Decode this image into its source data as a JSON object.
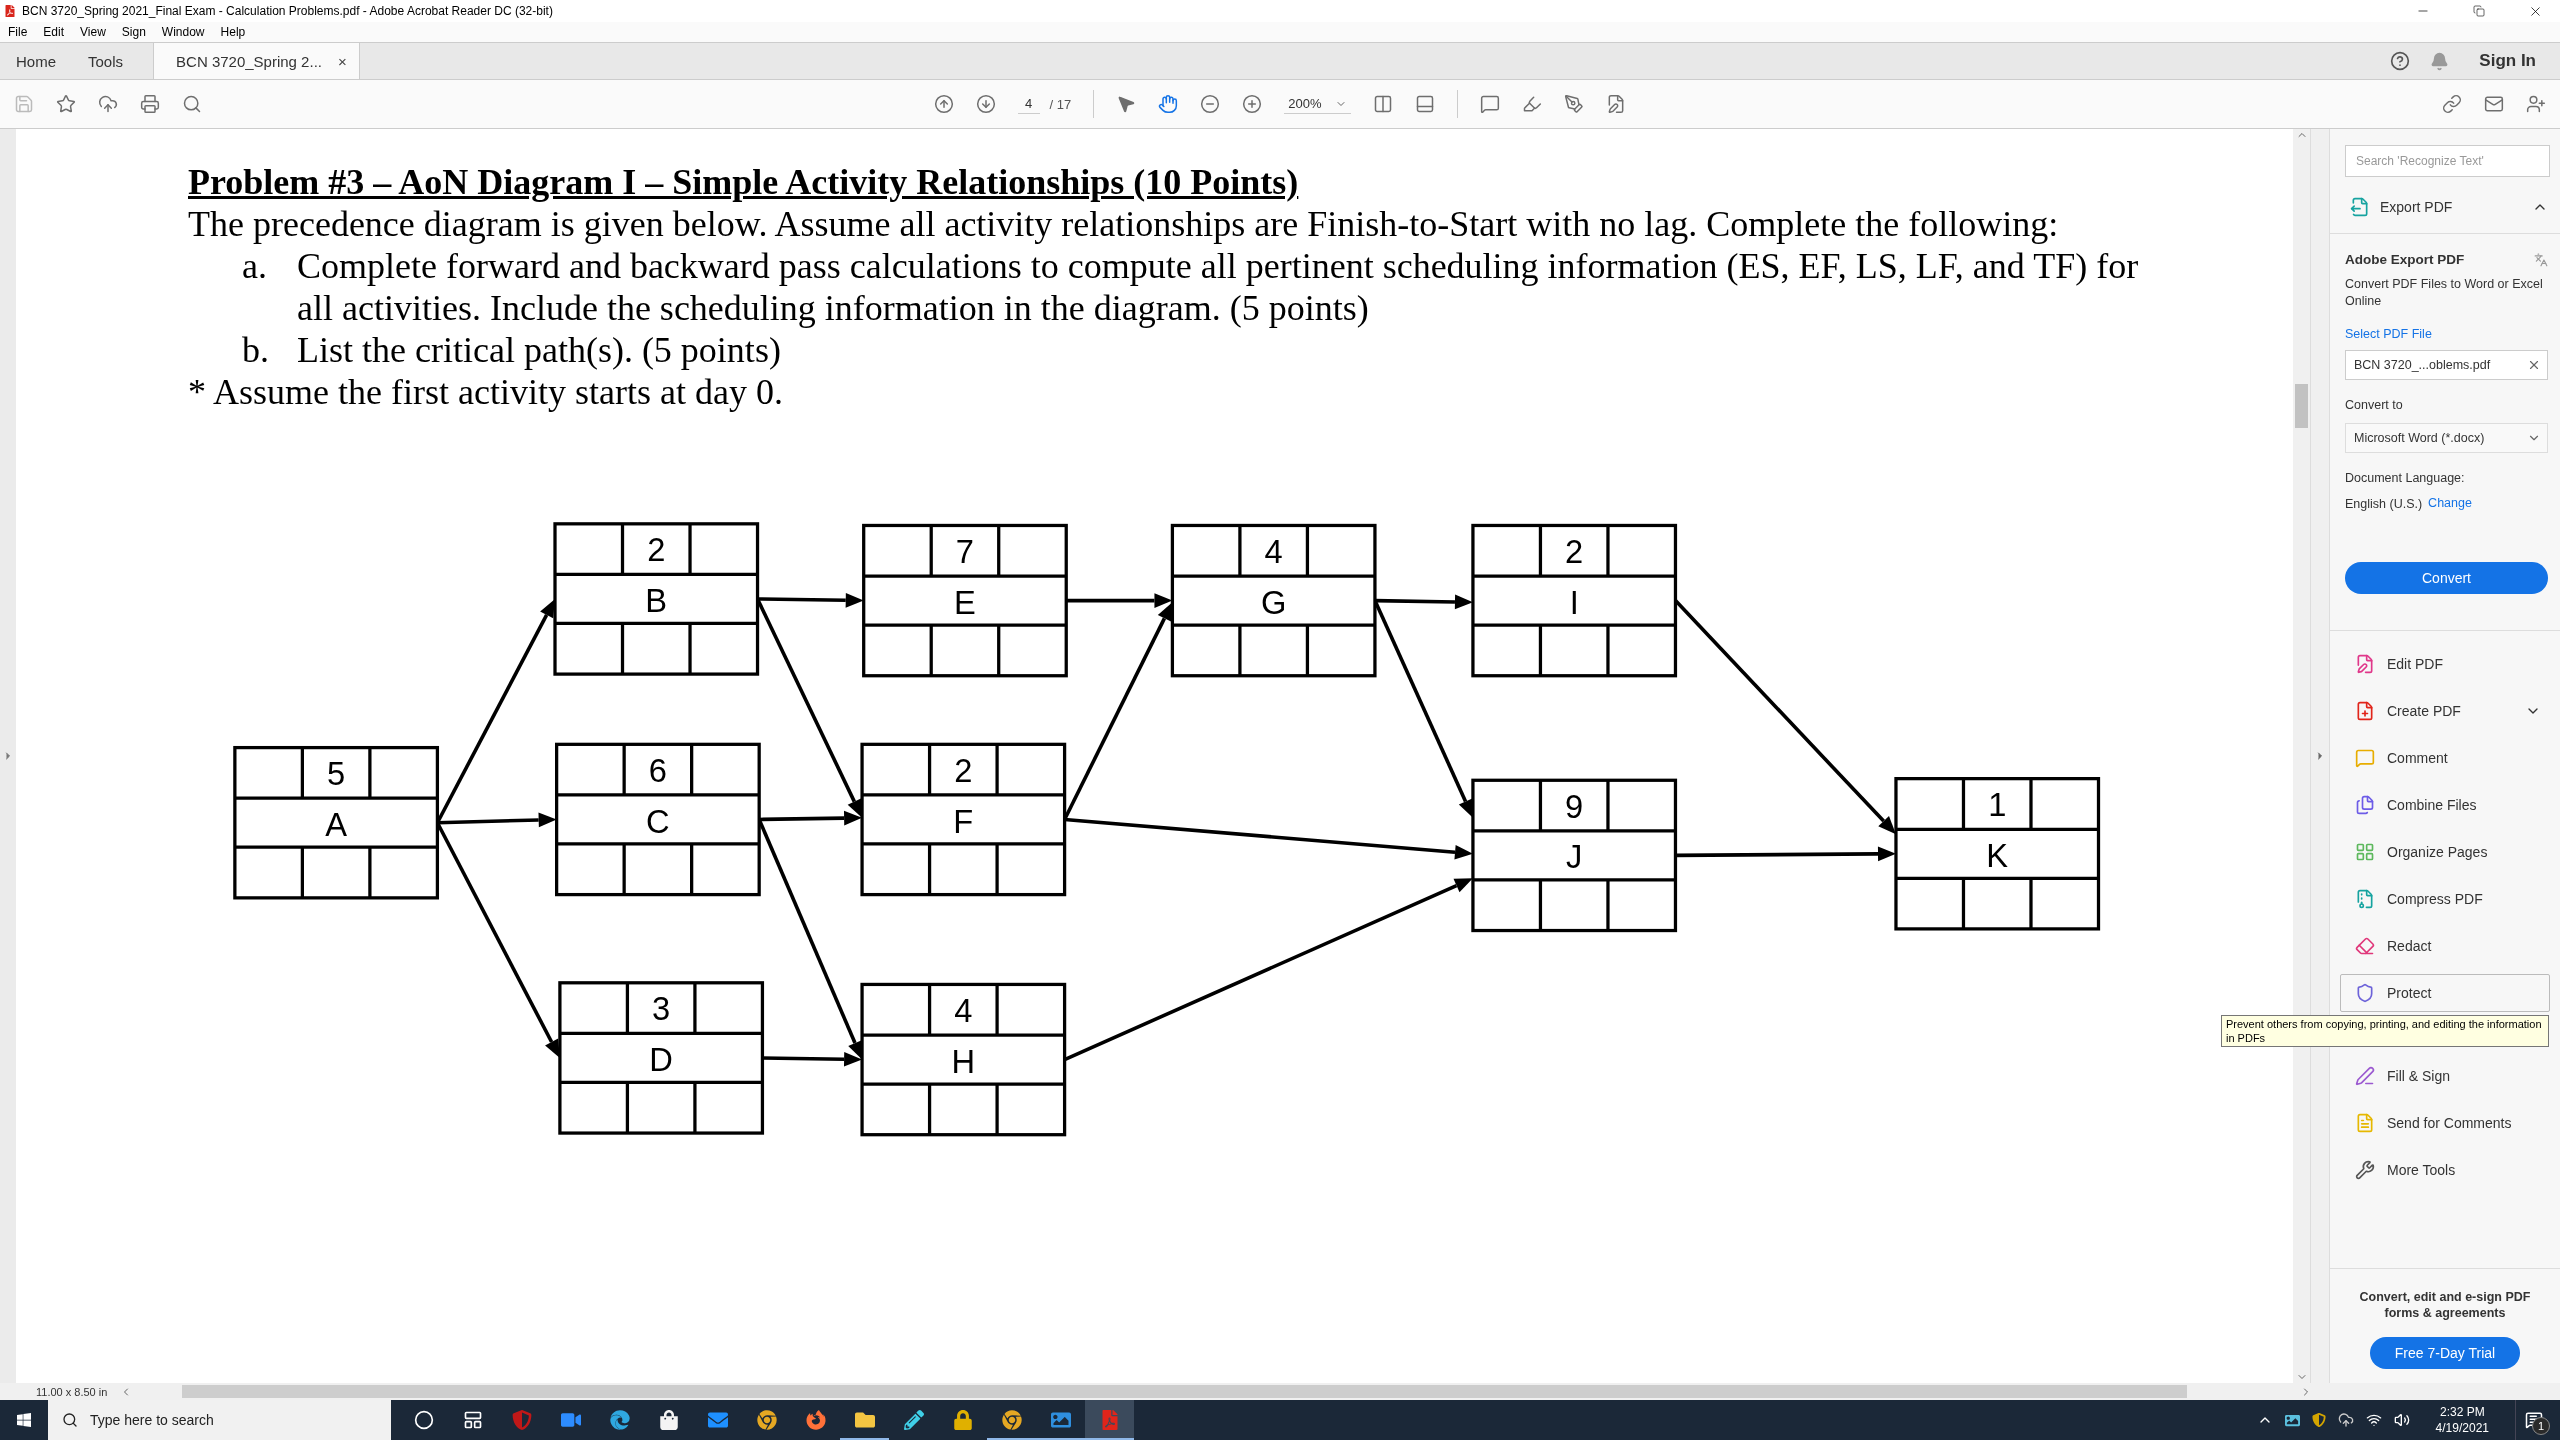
{
  "window": {
    "title": "BCN 3720_Spring 2021_Final Exam - Calculation Problems.pdf - Adobe Acrobat Reader DC (32-bit)"
  },
  "menu": [
    "File",
    "Edit",
    "View",
    "Sign",
    "Window",
    "Help"
  ],
  "tabs": [
    {
      "label": "Home",
      "selected": false
    },
    {
      "label": "Tools",
      "selected": false
    },
    {
      "label": "BCN 3720_Spring 2...",
      "selected": true,
      "close": "×"
    }
  ],
  "account": {
    "sign_in": "Sign In"
  },
  "toolbar": {
    "page": "4",
    "page_total": "/ 17",
    "zoom": "200%",
    "tools": [
      {
        "kind": "select",
        "selected": false
      },
      {
        "kind": "hand",
        "selected": true
      }
    ]
  },
  "document": {
    "heading": "Problem #3 – AoN Diagram I – Simple Activity Relationships (10 Points)",
    "intro": "The precedence diagram is given below. Assume all activity relationships are Finish-to-Start with no lag. Complete the following:",
    "items": [
      {
        "marker": "a.",
        "text": "Complete forward and backward pass calculations to compute all pertinent scheduling information (ES, EF, LS, LF, and TF) for all activities. Include the scheduling information in the diagram. (5 points)"
      },
      {
        "marker": "b.",
        "text": "List the critical path(s). (5 points)"
      }
    ],
    "note": "* Assume the first activity starts at day 0.",
    "diagram": {
      "nodes": [
        {
          "duration": "5",
          "name": "A"
        },
        {
          "duration": "2",
          "name": "B"
        },
        {
          "duration": "6",
          "name": "C"
        },
        {
          "duration": "3",
          "name": "D"
        },
        {
          "duration": "7",
          "name": "E"
        },
        {
          "duration": "2",
          "name": "F"
        },
        {
          "duration": "4",
          "name": "G"
        },
        {
          "duration": "4",
          "name": "H"
        },
        {
          "duration": "2",
          "name": "I"
        },
        {
          "duration": "9",
          "name": "J"
        },
        {
          "duration": "1",
          "name": "K"
        }
      ]
    }
  },
  "page_size": "11.00 x 8.50 in",
  "panel": {
    "search_placeholder": "Search 'Recognize Text'",
    "export": {
      "title": "Export PDF",
      "expanded": true,
      "heading": "Adobe Export PDF",
      "description": "Convert PDF Files to Word or Excel Online",
      "select_link": "Select PDF File",
      "file": "BCN 3720_...oblems.pdf",
      "convert_to_label": "Convert to",
      "format": "Microsoft Word (*.docx)",
      "language_label": "Document Language:",
      "language": "English (U.S.)",
      "change_link": "Change",
      "convert_button": "Convert"
    },
    "tools": [
      {
        "label": "Edit PDF",
        "kind": "edit",
        "expandable": false,
        "hovered": false
      },
      {
        "label": "Create PDF",
        "kind": "create",
        "expandable": true,
        "hovered": false
      },
      {
        "label": "Comment",
        "kind": "comment",
        "expandable": false,
        "hovered": false
      },
      {
        "label": "Combine Files",
        "kind": "combine",
        "expandable": false,
        "hovered": false
      },
      {
        "label": "Organize Pages",
        "kind": "organize",
        "expandable": false,
        "hovered": false
      },
      {
        "label": "Compress PDF",
        "kind": "compress",
        "expandable": false,
        "hovered": false
      },
      {
        "label": "Redact",
        "kind": "redact",
        "expandable": false,
        "hovered": false
      },
      {
        "label": "Protect",
        "kind": "protect",
        "expandable": false,
        "hovered": true
      },
      {
        "label": "Fill & Sign",
        "kind": "sign",
        "expandable": false,
        "hovered": false
      },
      {
        "label": "Send for Comments",
        "kind": "send",
        "expandable": false,
        "hovered": false
      },
      {
        "label": "More Tools",
        "kind": "more",
        "expandable": false,
        "hovered": false
      }
    ],
    "promo": "Convert, edit and e-sign PDF forms & agreements",
    "trial_button": "Free 7-Day Trial"
  },
  "tooltip": "Prevent others from copying, printing, and editing the information in PDFs",
  "taskbar": {
    "search_placeholder": "Type here to search",
    "apps": [
      {
        "kind": "cortana",
        "running": false,
        "active": false
      },
      {
        "kind": "taskview",
        "running": false,
        "active": false
      },
      {
        "kind": "mcafee",
        "running": false,
        "active": false
      },
      {
        "kind": "zoom",
        "running": false,
        "active": false
      },
      {
        "kind": "edge",
        "running": false,
        "active": false
      },
      {
        "kind": "store",
        "running": false,
        "active": false
      },
      {
        "kind": "mail",
        "running": false,
        "active": false
      },
      {
        "kind": "chrome",
        "running": false,
        "active": false
      },
      {
        "kind": "firefox",
        "running": false,
        "active": false
      },
      {
        "kind": "files",
        "running": true,
        "active": false
      },
      {
        "kind": "paint",
        "running": false,
        "active": false
      },
      {
        "kind": "vpn",
        "running": false,
        "active": false
      },
      {
        "kind": "chrome",
        "running": true,
        "active": false
      },
      {
        "kind": "photos",
        "running": true,
        "active": false
      },
      {
        "kind": "acrobat",
        "running": true,
        "active": true
      }
    ],
    "time": "2:32 PM",
    "date": "4/19/2021",
    "notifications": "1"
  }
}
